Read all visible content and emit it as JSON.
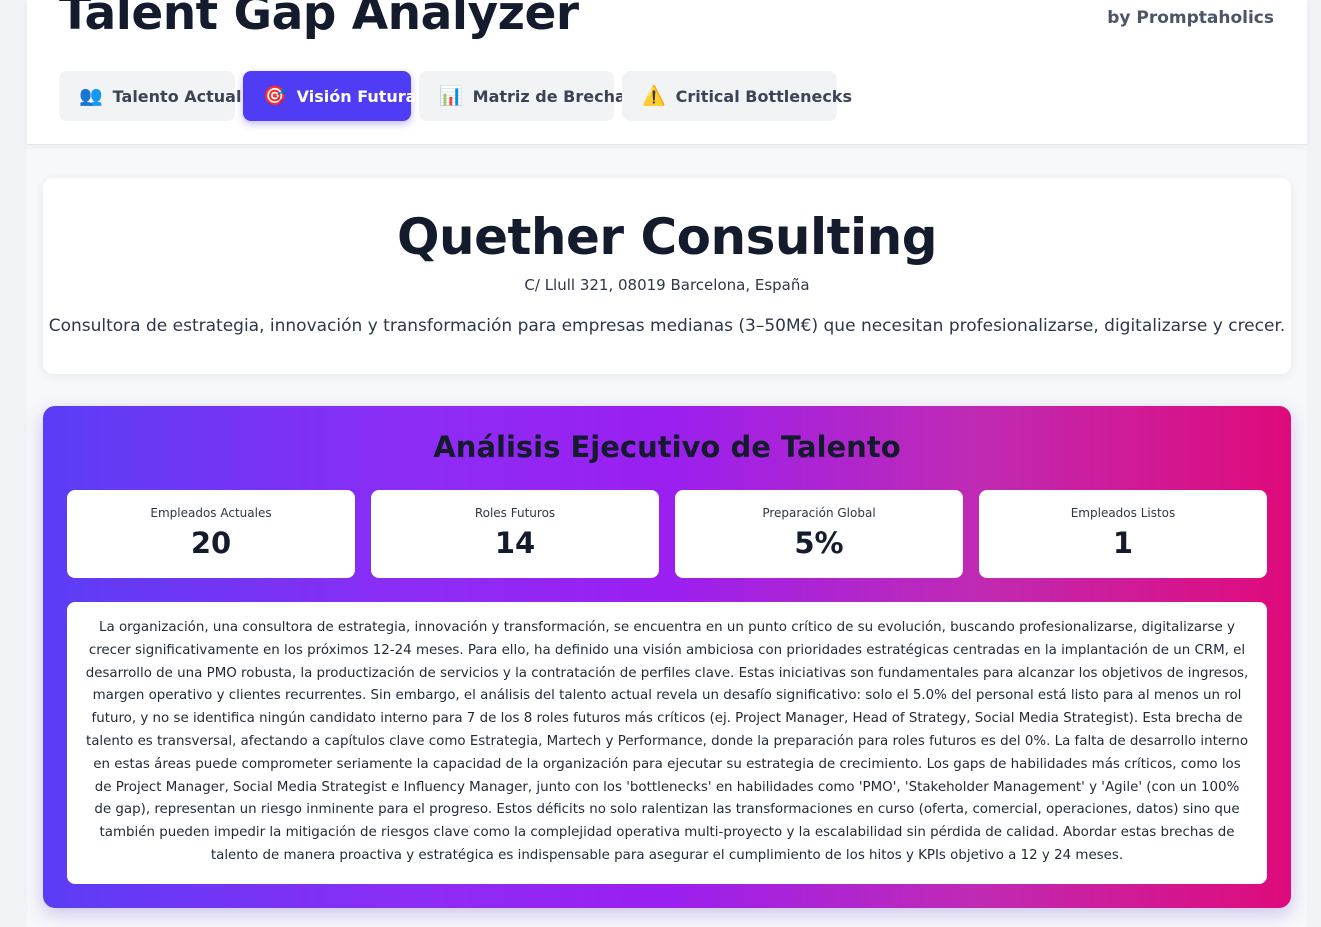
{
  "header": {
    "title": "Talent Gap Analyzer",
    "byline": "by Promptaholics",
    "tabs": [
      {
        "label": "Talento Actual",
        "icon": "👥",
        "icon_name": "people-icon",
        "active": false
      },
      {
        "label": "Visión Futura",
        "icon": "🎯",
        "icon_name": "target-icon",
        "active": true
      },
      {
        "label": "Matriz de Brecha",
        "icon": "📊",
        "icon_name": "bar-chart-icon",
        "active": false
      },
      {
        "label": "Critical Bottlenecks",
        "icon": "⚠️",
        "icon_name": "warning-icon",
        "active": false
      }
    ]
  },
  "company": {
    "name": "Quether Consulting",
    "address": "C/ Llull 321, 08019 Barcelona, España",
    "description": "Consultora de estrategia, innovación y transformación para empresas medianas (3–50M€) que necesitan profesionalizarse, digitalizarse y crecer."
  },
  "executive": {
    "title": "Análisis Ejecutivo de Talento",
    "stats": [
      {
        "label": "Empleados Actuales",
        "value": "20"
      },
      {
        "label": "Roles Futuros",
        "value": "14"
      },
      {
        "label": "Preparación Global",
        "value": "5%"
      },
      {
        "label": "Empleados Listos",
        "value": "1"
      }
    ],
    "summary": "La organización, una consultora de estrategia, innovación y transformación, se encuentra en un punto crítico de su evolución, buscando profesionalizarse, digitalizarse y crecer significativamente en los próximos 12-24 meses. Para ello, ha definido una visión ambiciosa con prioridades estratégicas centradas en la implantación de un CRM, el desarrollo de una PMO robusta, la productización de servicios y la contratación de perfiles clave. Estas iniciativas son fundamentales para alcanzar los objetivos de ingresos, margen operativo y clientes recurrentes. Sin embargo, el análisis del talento actual revela un desafío significativo: solo el 5.0% del personal está listo para al menos un rol futuro, y no se identifica ningún candidato interno para 7 de los 8 roles futuros más críticos (ej. Project Manager, Head of Strategy, Social Media Strategist). Esta brecha de talento es transversal, afectando a capítulos clave como Estrategia, Martech y Performance, donde la preparación para roles futuros es del 0%. La falta de desarrollo interno en estas áreas puede comprometer seriamente la capacidad de la organización para ejecutar su estrategia de crecimiento. Los gaps de habilidades más críticos, como los de Project Manager, Social Media Strategist e Influency Manager, junto con los 'bottlenecks' en habilidades como 'PMO', 'Stakeholder Management' y 'Agile' (con un 100% de gap), representan un riesgo inminente para el progreso. Estos déficits no solo ralentizan las transformaciones en curso (oferta, comercial, operaciones, datos) sino que también pueden impedir la mitigación de riesgos clave como la complejidad operativa multi-proyecto y la escalabilidad sin pérdida de calidad. Abordar estas brechas de talento de manera proactiva y estratégica es indispensable para asegurar el cumplimiento de los hitos y KPIs objetivo a 12 y 24 meses."
  }
}
